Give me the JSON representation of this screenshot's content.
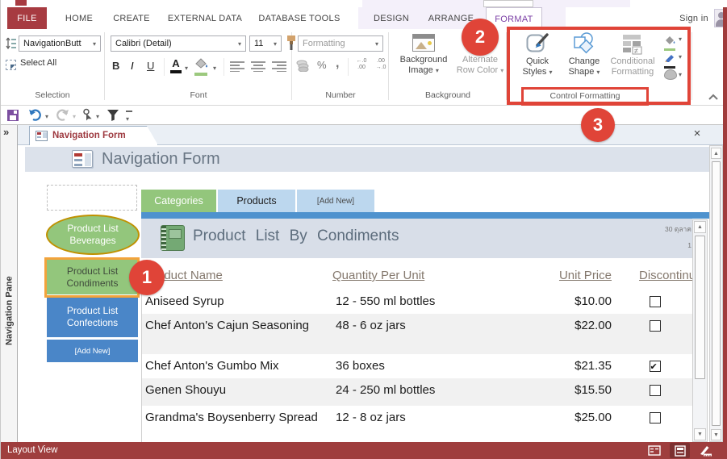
{
  "ribbon": {
    "tabs": [
      {
        "label": "FILE"
      },
      {
        "label": "HOME"
      },
      {
        "label": "CREATE"
      },
      {
        "label": "EXTERNAL DATA"
      },
      {
        "label": "DATABASE TOOLS"
      },
      {
        "label": "DESIGN"
      },
      {
        "label": "ARRANGE"
      },
      {
        "label": "FORMAT"
      }
    ],
    "sign_in_label": "Sign in",
    "groups": {
      "selection": {
        "label": "Selection",
        "combo_value": "NavigationButt",
        "select_all_label": "Select All"
      },
      "font": {
        "label": "Font",
        "font_name": "Calibri (Detail)",
        "font_size": "11",
        "bold": "B",
        "italic": "I",
        "underline": "U"
      },
      "number": {
        "label": "Number",
        "formatting_placeholder": "Formatting",
        "percent": "%",
        "comma": ",",
        "decrease_decimal": "←.0 .00",
        "increase_decimal": ".00 →.0"
      },
      "background": {
        "label": "Background",
        "background_image_label": "Background Image",
        "alternate_row_color_label": "Alternate Row Color"
      },
      "control_formatting": {
        "label": "Control Formatting",
        "quick_styles_label": "Quick Styles",
        "change_shape_label": "Change Shape",
        "conditional_formatting_label": "Conditional Formatting"
      }
    }
  },
  "annotations": {
    "step1": "1",
    "step2": "2",
    "step3": "3"
  },
  "document": {
    "tab_label": "Navigation Form",
    "close_glyph": "×",
    "form_title": "Navigation Form",
    "nav_tabs": [
      {
        "label": "Categories"
      },
      {
        "label": "Products"
      },
      {
        "label": "[Add New]"
      }
    ],
    "nav_buttons": [
      {
        "label": "Product List Beverages"
      },
      {
        "label": "Product List Condiments"
      },
      {
        "label": "Product List Confections"
      },
      {
        "label": "[Add New]"
      }
    ],
    "subform": {
      "title": "Product List By Condiments",
      "corner_date": "30 ตุลาค",
      "corner_page": "1",
      "columns": [
        "Product Name",
        "Quantity Per Unit",
        "Unit Price",
        "Discontinued"
      ],
      "rows": [
        {
          "name": "Aniseed Syrup",
          "quantity": "12 - 550 ml bottles",
          "price": "$10.00",
          "discontinued": false
        },
        {
          "name": "Chef Anton's Cajun Seasoning",
          "quantity": "48 - 6 oz jars",
          "price": "$22.00",
          "discontinued": false
        },
        {
          "name": "Chef Anton's Gumbo Mix",
          "quantity": "36 boxes",
          "price": "$21.35",
          "discontinued": true
        },
        {
          "name": "Genen Shouyu",
          "quantity": "24 - 250 ml bottles",
          "price": "$15.50",
          "discontinued": false
        },
        {
          "name": "Grandma's Boysenberry Spread",
          "quantity": "12 - 8 oz jars",
          "price": "$25.00",
          "discontinued": false
        }
      ]
    }
  },
  "navigation_pane": {
    "label": "Navigation Pane",
    "shutter_glyph": "»"
  },
  "status_bar": {
    "view_label": "Layout View"
  },
  "colors": {
    "annotation_red": "#E04438",
    "highlight_orange": "#F2A33C",
    "accent_green": "#93C67C",
    "accent_blue": "#4A86C8",
    "file_tab_red": "#A73B41",
    "status_red": "#9F3E3E",
    "format_tab_purple": "#7B3FA5"
  }
}
